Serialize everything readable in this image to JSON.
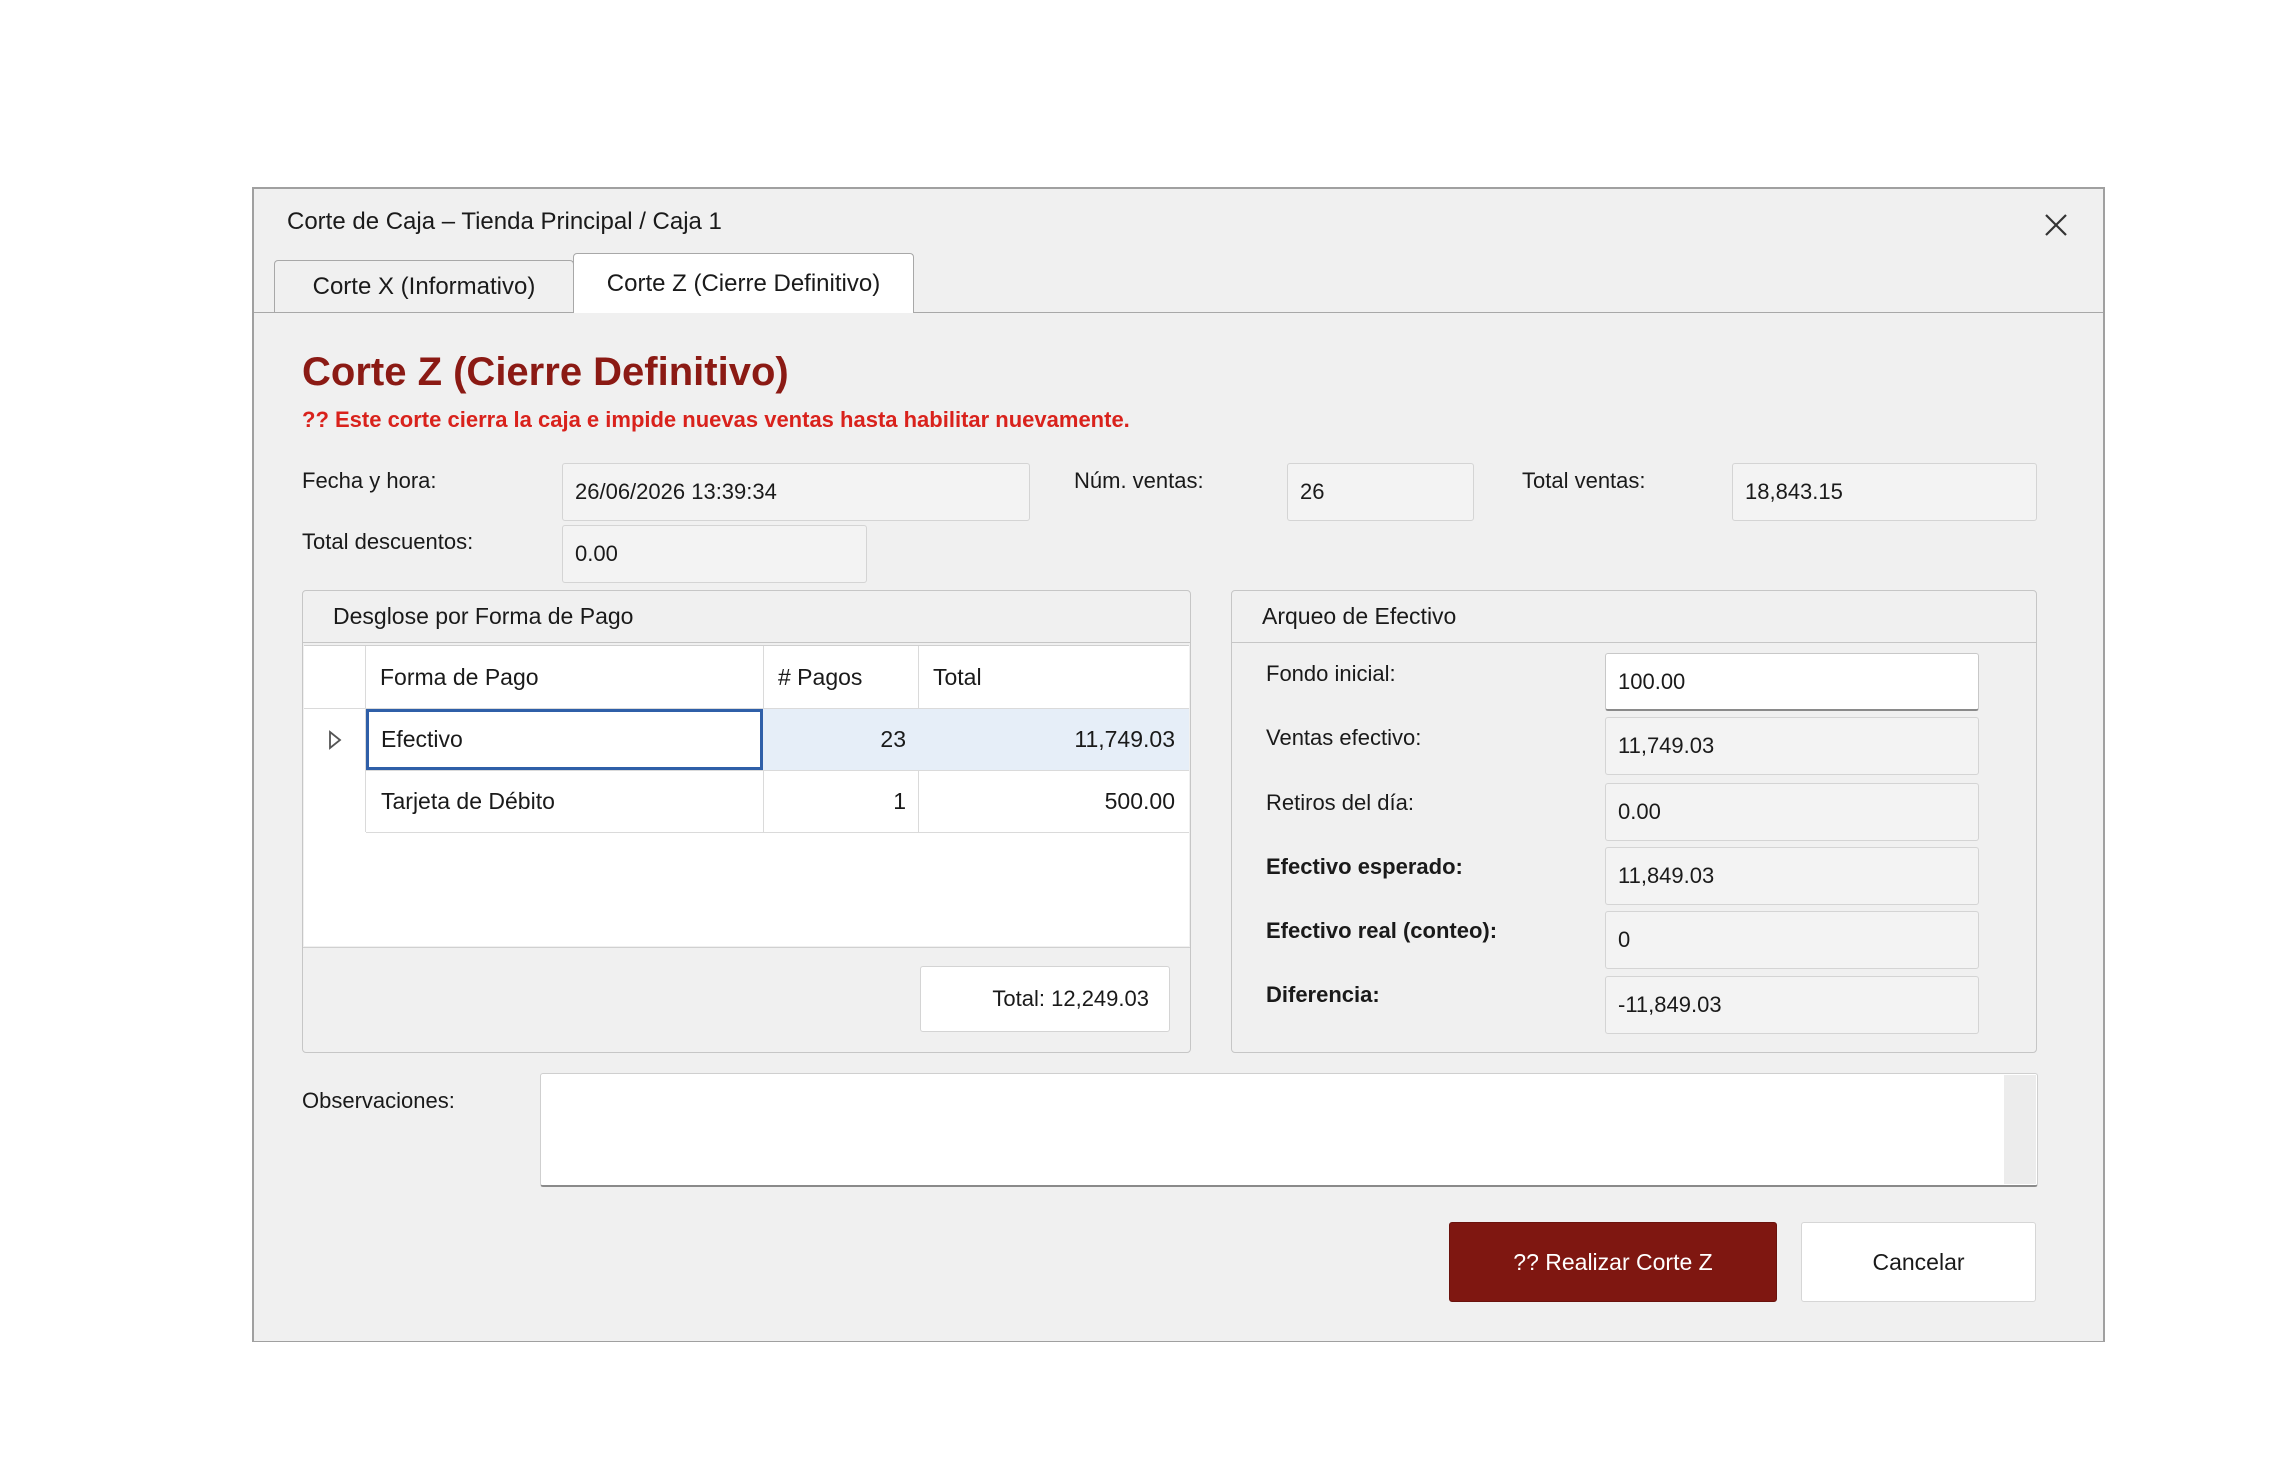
{
  "window": {
    "title": "Corte de Caja – Tienda Principal / Caja 1"
  },
  "tabs": [
    {
      "label": "Corte X (Informativo)",
      "active": false
    },
    {
      "label": "Corte Z (Cierre Definitivo)",
      "active": true
    }
  ],
  "main": {
    "heading": "Corte Z (Cierre Definitivo)",
    "warning": "?? Este corte cierra la caja e impide nuevas ventas hasta habilitar nuevamente.",
    "fecha_label": "Fecha y hora:",
    "fecha_value": "26/06/2026 13:39:34",
    "num_ventas_label": "Núm. ventas:",
    "num_ventas_value": "26",
    "total_ventas_label": "Total ventas:",
    "total_ventas_value": "18,843.15",
    "total_descuentos_label": "Total descuentos:",
    "total_descuentos_value": "0.00"
  },
  "desglose": {
    "title": "Desglose por Forma de Pago",
    "columns": [
      "Forma de Pago",
      "# Pagos",
      "Total"
    ],
    "rows": [
      {
        "forma": "Efectivo",
        "pagos": "23",
        "total": "11,749.03"
      },
      {
        "forma": "Tarjeta de Débito",
        "pagos": "1",
        "total": "500.00"
      }
    ],
    "total_label": "Total: 12,249.03"
  },
  "arqueo": {
    "title": "Arqueo de Efectivo",
    "fondo_inicial_label": "Fondo inicial:",
    "fondo_inicial_value": "100.00",
    "ventas_efectivo_label": "Ventas efectivo:",
    "ventas_efectivo_value": "11,749.03",
    "retiros_label": "Retiros del día:",
    "retiros_value": "0.00",
    "esperado_label": "Efectivo esperado:",
    "esperado_value": "11,849.03",
    "real_label": "Efectivo real (conteo):",
    "real_value": "0",
    "diferencia_label": "Diferencia:",
    "diferencia_value": "-11,849.03"
  },
  "observaciones": {
    "label": "Observaciones:",
    "value": ""
  },
  "buttons": {
    "realizar": "?? Realizar Corte Z",
    "cancelar": "Cancelar"
  },
  "colors": {
    "accent": "#7f1711",
    "heading": "#8b1a14",
    "warning": "#d9221c",
    "selection_border": "#2f5fa8"
  }
}
